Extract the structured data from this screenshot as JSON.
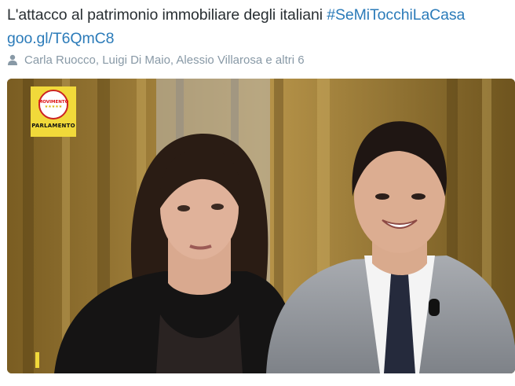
{
  "tweet": {
    "text": "L'attacco al patrimonio immobiliare degli italiani",
    "hashtag": "#SeMiTocchiLaCasa",
    "link": "goo.gl/T6QmC8"
  },
  "tagged": {
    "icon": "person-icon",
    "names": "Carla Ruocco, Luigi Di Maio, Alessio Villarosa",
    "connector": " e ",
    "more": "altri 6"
  },
  "media": {
    "logo": {
      "word": "MOVIMENTO",
      "stars": "★★★★★",
      "label": "PARLAMENTO"
    }
  }
}
